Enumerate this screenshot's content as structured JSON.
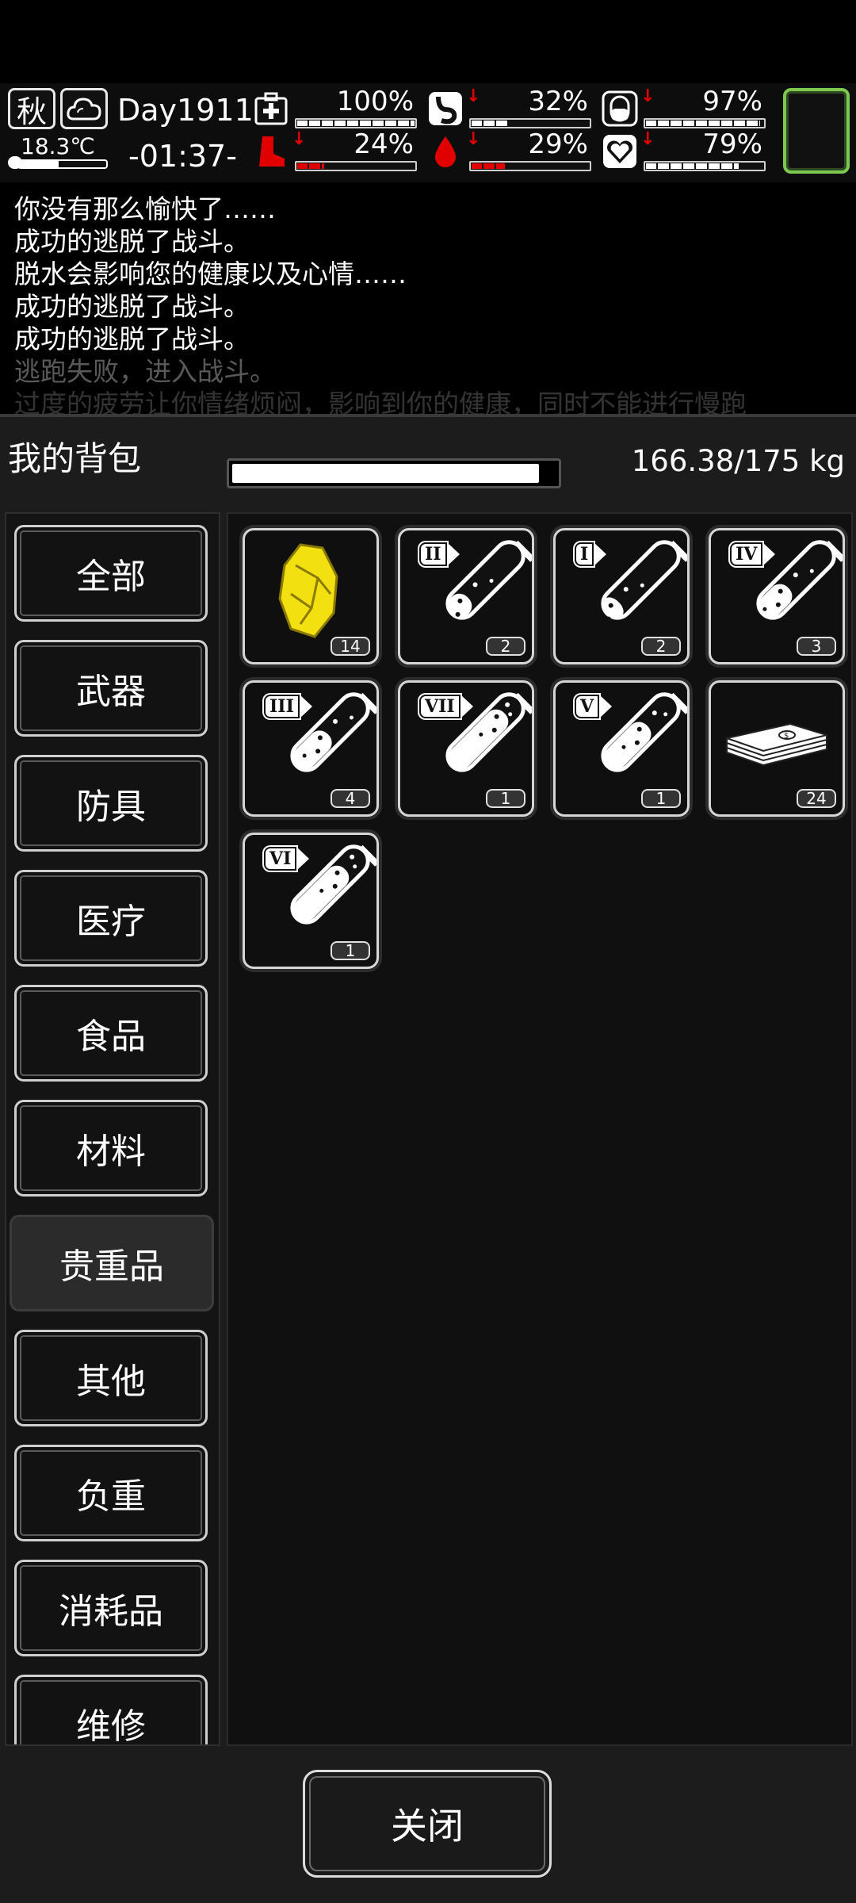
{
  "hud": {
    "season": "秋",
    "weather_icon": "cloud-icon",
    "temperature": "18.3℃",
    "day": "Day1911",
    "time": "-01:37-",
    "stats": [
      {
        "name": "health",
        "icon": "medkit-icon",
        "value": "100%",
        "fill": 1.0,
        "color": "#ffffff",
        "trend": "none"
      },
      {
        "name": "hunger",
        "icon": "stomach-icon",
        "value": "32%",
        "fill": 0.32,
        "color": "#ffffff",
        "trend": "down"
      },
      {
        "name": "sanity",
        "icon": "pill-icon",
        "value": "97%",
        "fill": 0.97,
        "color": "#ffffff",
        "trend": "down"
      },
      {
        "name": "stamina",
        "icon": "boot-icon",
        "value": "24%",
        "fill": 0.24,
        "color": "#e00000",
        "trend": "down"
      },
      {
        "name": "thirst",
        "icon": "water-drop-icon",
        "value": "29%",
        "fill": 0.29,
        "color": "#e00000",
        "trend": "down"
      },
      {
        "name": "mood",
        "icon": "heart-icon",
        "value": "79%",
        "fill": 0.79,
        "color": "#ffffff",
        "trend": "down"
      }
    ],
    "accent": "#7ec850"
  },
  "log": [
    {
      "text": "你没有那么愉快了……",
      "opacity": 1
    },
    {
      "text": "成功的逃脱了战斗。",
      "opacity": 1
    },
    {
      "text": "脱水会影响您的健康以及心情……",
      "opacity": 1
    },
    {
      "text": "成功的逃脱了战斗。",
      "opacity": 1
    },
    {
      "text": "成功的逃脱了战斗。",
      "opacity": 1
    },
    {
      "text": "逃跑失败，进入战斗。",
      "opacity": 0.35
    },
    {
      "text": "过度的疲劳让你情绪烦闷，影响到你的健康，同时不能进行慢跑",
      "opacity": 0.2
    }
  ],
  "inventory": {
    "title": "我的背包",
    "weight": "166.38/175 kg",
    "weight_fill": 0.95,
    "categories": [
      "全部",
      "武器",
      "防具",
      "医疗",
      "食品",
      "材料",
      "贵重品",
      "其他",
      "负重",
      "消耗品",
      "维修"
    ],
    "active_category": "贵重品",
    "items": [
      {
        "icon": "gold-nugget-icon",
        "count": "14"
      },
      {
        "icon": "test-tube-icon",
        "roman": "II",
        "level": 0.28,
        "count": "2"
      },
      {
        "icon": "test-tube-icon",
        "roman": "I",
        "level": 0.2,
        "count": "2"
      },
      {
        "icon": "test-tube-icon",
        "roman": "IV",
        "level": 0.45,
        "count": "3"
      },
      {
        "icon": "test-tube-icon",
        "roman": "III",
        "level": 0.55,
        "count": "4"
      },
      {
        "icon": "test-tube-icon",
        "roman": "VII",
        "level": 0.92,
        "count": "1"
      },
      {
        "icon": "test-tube-icon",
        "roman": "V",
        "level": 0.7,
        "count": "1"
      },
      {
        "icon": "cash-stack-icon",
        "count": "24"
      },
      {
        "icon": "test-tube-icon",
        "roman": "VI",
        "level": 0.85,
        "count": "1"
      }
    ]
  },
  "close_label": "关闭"
}
